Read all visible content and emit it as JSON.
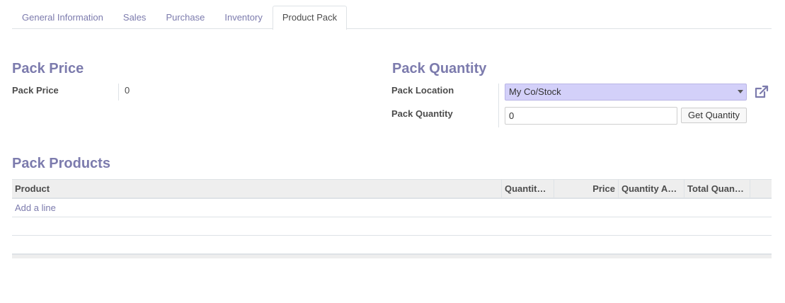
{
  "tabs": [
    {
      "label": "General Information"
    },
    {
      "label": "Sales"
    },
    {
      "label": "Purchase"
    },
    {
      "label": "Inventory"
    },
    {
      "label": "Product Pack"
    }
  ],
  "pack_price": {
    "title": "Pack Price",
    "label": "Pack Price",
    "value": "0"
  },
  "pack_quantity": {
    "title": "Pack Quantity",
    "location_label": "Pack Location",
    "location_value": "My Co/Stock",
    "quantity_label": "Pack Quantity",
    "quantity_value": "0",
    "get_quantity_label": "Get Quantity",
    "external_link_icon": "external-link-icon"
  },
  "pack_products": {
    "title": "Pack Products",
    "columns": [
      "Product",
      "Quantity…",
      "Price",
      "Quantity A…",
      "Total Quan…"
    ],
    "add_line_label": "Add a line"
  },
  "colors": {
    "accent": "#7c7bad",
    "select_bg": "#d3d0f9"
  }
}
